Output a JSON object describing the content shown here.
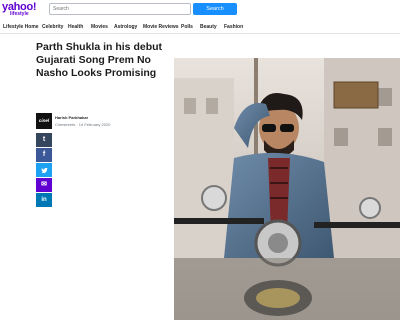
{
  "header": {
    "logo_text": "yahoo!",
    "logo_sub": "lifestyle",
    "search_placeholder": "Search",
    "search_button_label": "Search"
  },
  "nav": {
    "items": [
      {
        "label": "Lifestyle Home"
      },
      {
        "label": "Celebrity"
      },
      {
        "label": "Health"
      },
      {
        "label": "Movies"
      },
      {
        "label": "Astrology"
      },
      {
        "label": "Movie Reviews"
      },
      {
        "label": "Polls"
      },
      {
        "label": "Beauty"
      },
      {
        "label": "Fashion"
      }
    ]
  },
  "article": {
    "title": "Parth Shukla in his debut Gujarati Song Prem No Nasho Looks Promising",
    "author_logo": "cinel",
    "author_name": "Harish Parbhakar",
    "author_meta": "Cinestreets · 14 February 2020"
  },
  "share": {
    "buttons": [
      {
        "icon": "tumblr-icon",
        "glyph": "t",
        "color": "#35465c"
      },
      {
        "icon": "facebook-icon",
        "glyph": "f",
        "color": "#3b5998"
      },
      {
        "icon": "twitter-icon",
        "glyph": "🐦",
        "color": "#1da1f2"
      },
      {
        "icon": "mail-icon",
        "glyph": "✉",
        "color": "#6001d2"
      },
      {
        "icon": "linkedin-icon",
        "glyph": "in",
        "color": "#0077b5"
      }
    ]
  },
  "photo": {
    "alt": "Parth Shukla on a motorcycle"
  }
}
